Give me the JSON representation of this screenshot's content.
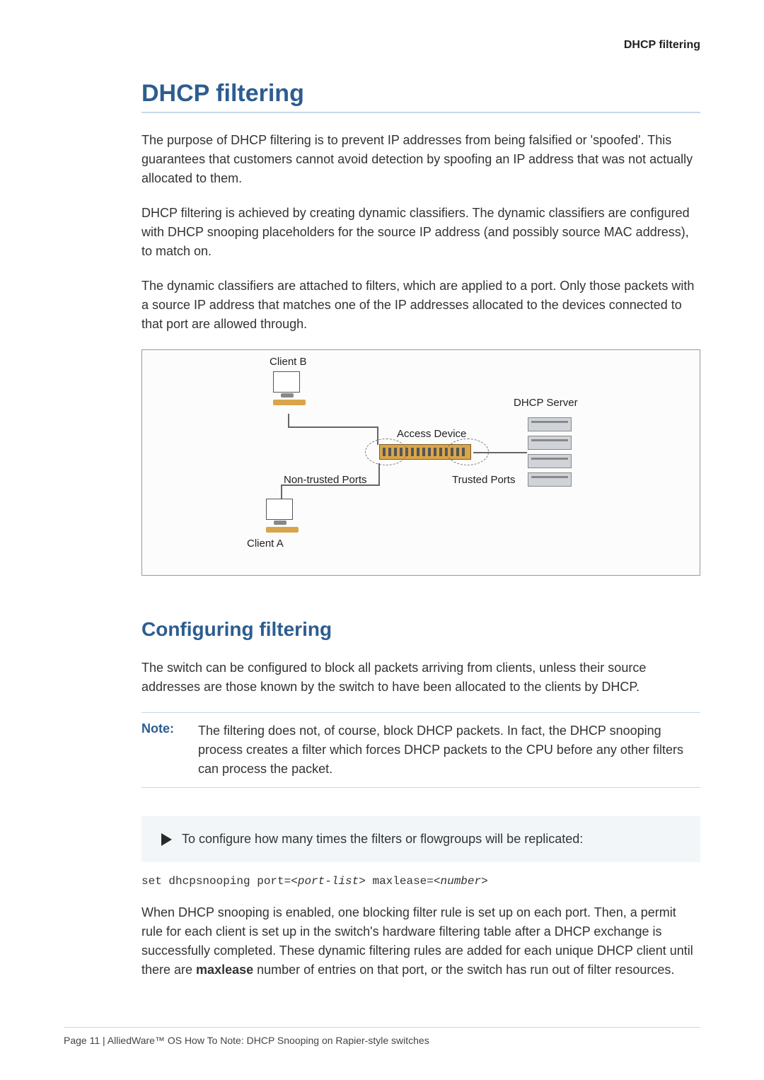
{
  "header": {
    "running_title": "DHCP filtering"
  },
  "section": {
    "title": "DHCP filtering",
    "para1": "The purpose of DHCP filtering is to prevent IP addresses from being falsified or 'spoofed'. This guarantees that customers cannot avoid detection by spoofing an IP address that was not actually allocated to them.",
    "para2": "DHCP filtering is achieved by creating dynamic classifiers. The dynamic classifiers are configured with DHCP snooping placeholders for the source IP address (and possibly source MAC address), to match on.",
    "para3": "The dynamic classifiers are attached to filters, which are applied to a port. Only those packets with a source IP address that matches one of the IP addresses allocated to the devices connected to that port are allowed through."
  },
  "diagram": {
    "client_b": "Client B",
    "client_a": "Client A",
    "access_device": "Access Device",
    "dhcp_server": "DHCP Server",
    "non_trusted": "Non-trusted Ports",
    "trusted": "Trusted Ports"
  },
  "subsection": {
    "title": "Configuring filtering",
    "para1": "The switch can be configured to block all packets arriving from clients, unless their source addresses are those known by the switch to have been allocated to the clients by DHCP.",
    "note_label": "Note:",
    "note_text": "The filtering does not, of course, block DHCP packets. In fact, the DHCP snooping process creates a filter which forces DHCP packets to the CPU before any other filters can process the packet.",
    "step": "To configure how many times the filters or flowgroups will be replicated:",
    "code_prefix": "set dhcpsnooping port=<",
    "code_param1": "port-list",
    "code_mid": "> maxlease=<",
    "code_param2": "number",
    "code_suffix": ">",
    "para2_a": "When DHCP snooping is enabled, one blocking filter rule is set up on each port. Then, a permit rule for each client is set up in the switch's hardware filtering table after a DHCP exchange is successfully completed. These dynamic filtering rules are added for each unique DHCP client until there are ",
    "para2_bold": "maxlease",
    "para2_b": " number of entries on that port, or the switch has run out of filter resources."
  },
  "footer": {
    "text": "Page 11 | AlliedWare™ OS How To Note: DHCP Snooping on Rapier-style switches"
  }
}
